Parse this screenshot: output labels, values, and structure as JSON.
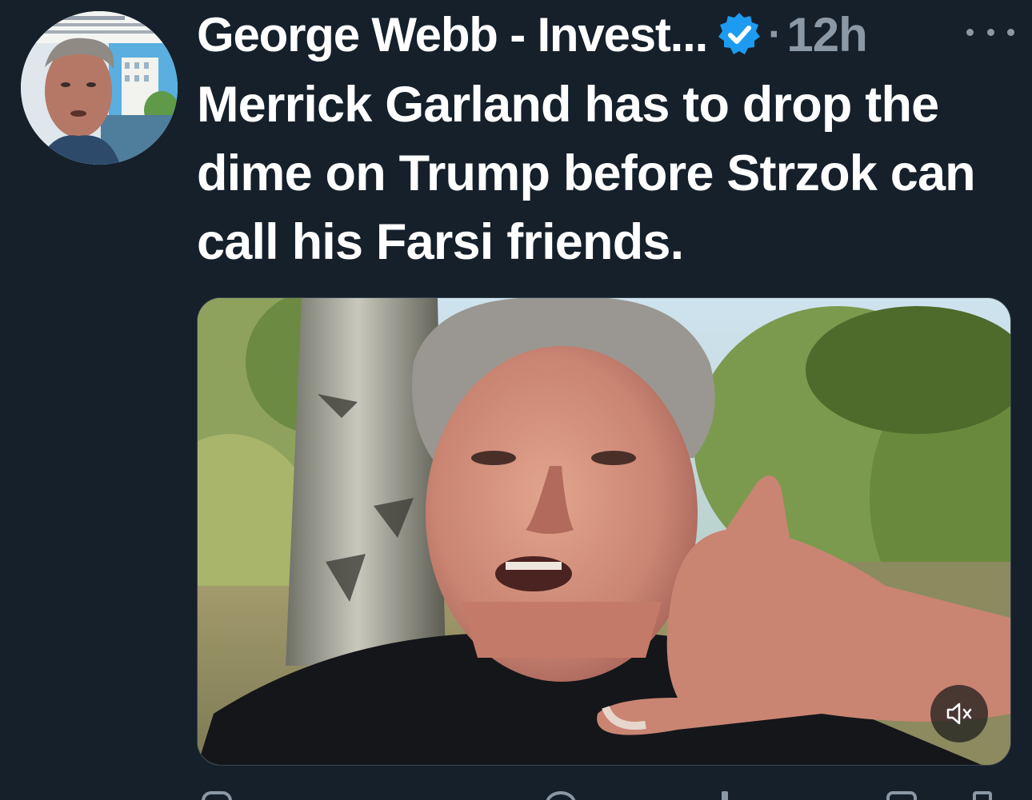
{
  "tweet": {
    "author": {
      "display_name": "George Webb - Invest...",
      "avatar_icon": "profile-photo",
      "verified_icon": "verified-badge-icon",
      "verified_color": "#1d9bf0"
    },
    "separator": "·",
    "timestamp": "12h",
    "more_icon": "more-options-icon",
    "text": "Merrick Garland has to drop the dime on Trump before Strzok can call his Farsi friends.",
    "media": {
      "type": "video",
      "mute_icon": "speaker-muted-icon"
    },
    "actions": [
      "reply-icon",
      "retweet-icon",
      "like-icon",
      "views-icon",
      "bookmark-icon",
      "share-icon"
    ]
  },
  "theme": {
    "background": "#15202b",
    "primary_text": "#ffffff",
    "secondary_text": "#8b98a5",
    "accent": "#1d9bf0"
  }
}
